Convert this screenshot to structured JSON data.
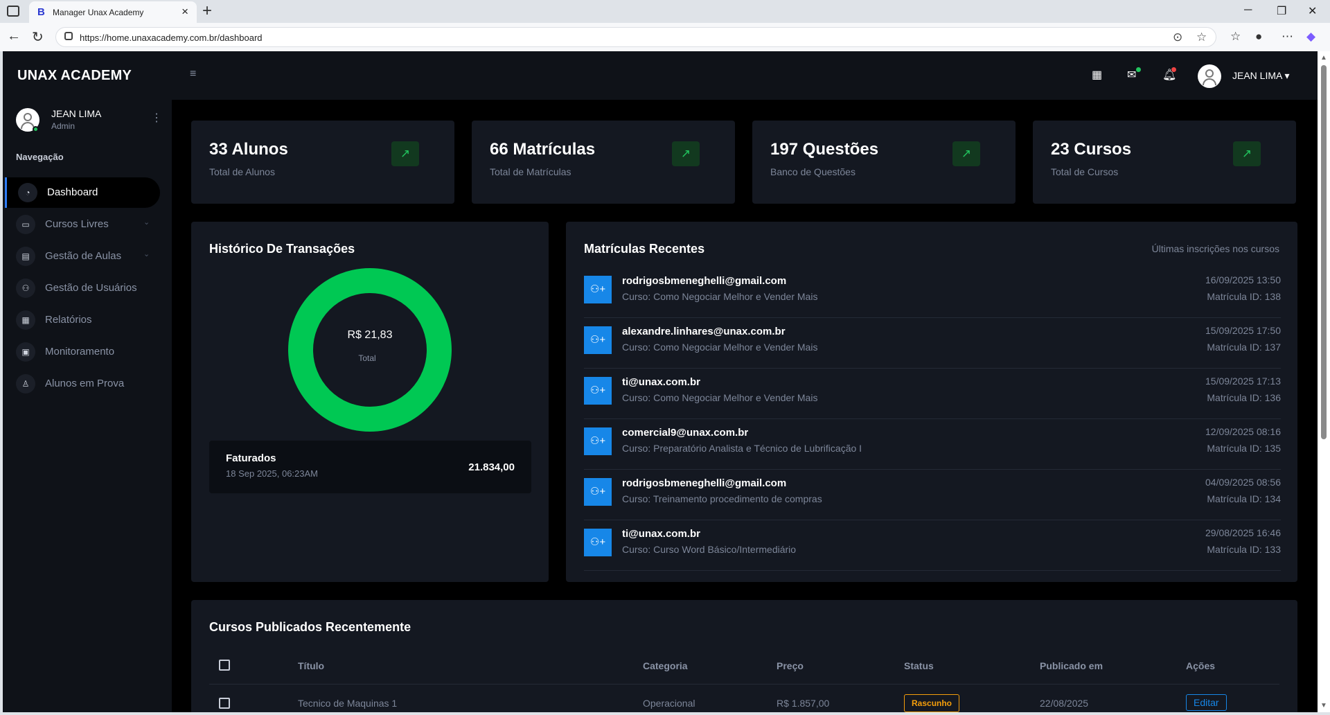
{
  "browser": {
    "tab_title": "Manager Unax Academy",
    "favicon": "B",
    "url": "https://home.unaxacademy.com.br/dashboard"
  },
  "sidebar": {
    "brand": "UNAX ACADEMY",
    "user_name": "JEAN LIMA",
    "user_role": "Admin",
    "nav_heading": "Navegação",
    "items": [
      {
        "label": "Dashboard",
        "icon": "dashboard-icon",
        "active": true,
        "chevron": false
      },
      {
        "label": "Cursos Livres",
        "icon": "laptop-icon",
        "active": false,
        "chevron": true
      },
      {
        "label": "Gestão de Aulas",
        "icon": "book-icon",
        "active": false,
        "chevron": true
      },
      {
        "label": "Gestão de Usuários",
        "icon": "users-icon",
        "active": false,
        "chevron": false
      },
      {
        "label": "Relatórios",
        "icon": "report-icon",
        "active": false,
        "chevron": false
      },
      {
        "label": "Monitoramento",
        "icon": "monitor-icon",
        "active": false,
        "chevron": false
      },
      {
        "label": "Alunos em Prova",
        "icon": "student-icon",
        "active": false,
        "chevron": false
      }
    ]
  },
  "topbar": {
    "user_name": "JEAN LIMA"
  },
  "stats": [
    {
      "value": "33 Alunos",
      "label": "Total de Alunos"
    },
    {
      "value": "66 Matrículas",
      "label": "Total de Matrículas"
    },
    {
      "value": "197 Questões",
      "label": "Banco de Questões"
    },
    {
      "value": "23 Cursos",
      "label": "Total de Cursos"
    }
  ],
  "transactions": {
    "title": "Histórico De Transações",
    "donut_value": "R$ 21,83",
    "donut_label": "Total",
    "donut_fill": 1.0,
    "donut_color": "#00c853",
    "billed_title": "Faturados",
    "billed_date": "18 Sep 2025, 06:23AM",
    "billed_amount": "21.834,00"
  },
  "enrollments": {
    "title": "Matrículas Recentes",
    "subtitle": "Últimas inscrições nos cursos",
    "rows": [
      {
        "email": "rodrigosbmeneghelli@gmail.com",
        "course": "Curso: Como Negociar Melhor e Vender Mais",
        "date": "16/09/2025 13:50",
        "id": "Matrícula ID: 138"
      },
      {
        "email": "alexandre.linhares@unax.com.br",
        "course": "Curso: Como Negociar Melhor e Vender Mais",
        "date": "15/09/2025 17:50",
        "id": "Matrícula ID: 137"
      },
      {
        "email": "ti@unax.com.br",
        "course": "Curso: Como Negociar Melhor e Vender Mais",
        "date": "15/09/2025 17:13",
        "id": "Matrícula ID: 136"
      },
      {
        "email": "comercial9@unax.com.br",
        "course": "Curso: Preparatório Analista e Técnico de Lubrificação I",
        "date": "12/09/2025 08:16",
        "id": "Matrícula ID: 135"
      },
      {
        "email": "rodrigosbmeneghelli@gmail.com",
        "course": "Curso: Treinamento procedimento de compras",
        "date": "04/09/2025 08:56",
        "id": "Matrícula ID: 134"
      },
      {
        "email": "ti@unax.com.br",
        "course": "Curso: Curso Word Básico/Intermediário",
        "date": "29/08/2025 16:46",
        "id": "Matrícula ID: 133"
      }
    ]
  },
  "courses": {
    "title": "Cursos Publicados Recentemente",
    "headers": {
      "title": "Título",
      "category": "Categoria",
      "price": "Preço",
      "status": "Status",
      "published": "Publicado em",
      "actions": "Ações"
    },
    "rows": [
      {
        "title": "Tecnico de Maquinas 1",
        "category": "Operacional",
        "price": "R$ 1.857,00",
        "status": "Rascunho",
        "published": "22/08/2025",
        "action": "Editar"
      }
    ]
  },
  "colors": {
    "accent_green": "#22c55e",
    "accent_blue": "#1787e8",
    "draft_orange": "#f59e0b"
  }
}
